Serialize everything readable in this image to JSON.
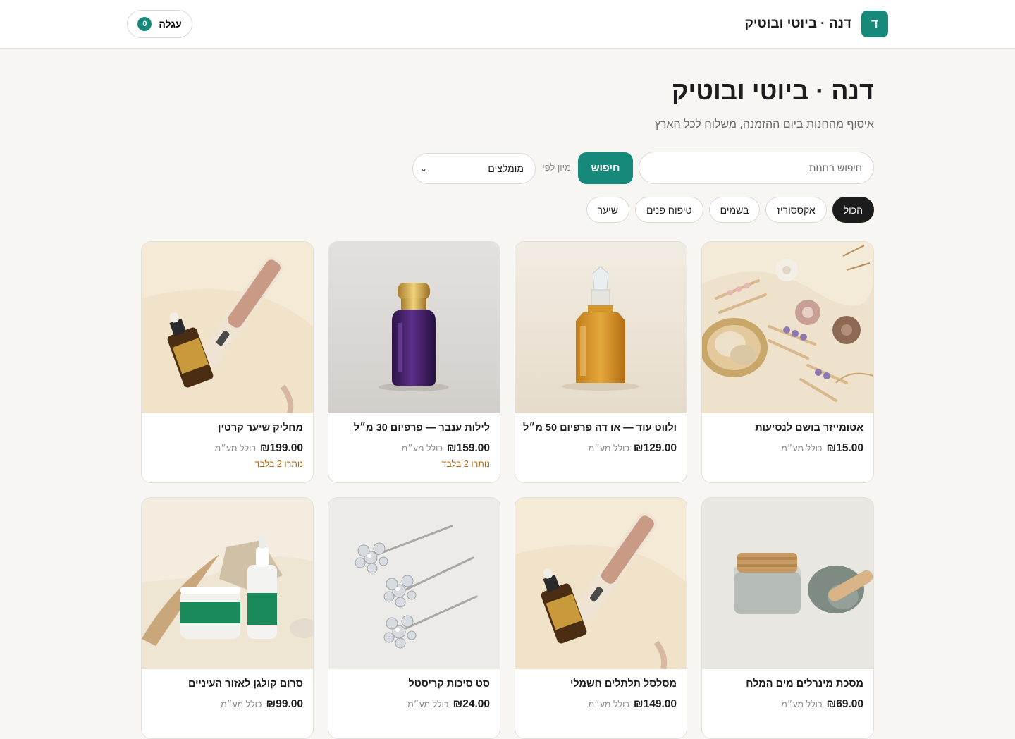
{
  "header": {
    "brand_logo_letter": "ד",
    "brand_name": "דנה · ביוטי ובוטיק",
    "cart_label": "עגלה",
    "cart_count": "0"
  },
  "hero": {
    "title": "דנה · ביוטי ובוטיק",
    "subtitle": "איסוף מהחנות ביום ההזמנה, משלוח לכל הארץ"
  },
  "search": {
    "placeholder": "חיפוש בחנות",
    "button_label": "חיפוש",
    "sort_label": "מיון לפי",
    "sort_value": "מומלצים"
  },
  "categories": [
    "הכול",
    "אקססוריז",
    "בשמים",
    "טיפוח פנים",
    "שיער"
  ],
  "active_category": "הכול",
  "products": [
    {
      "name": "אטומייזר בושם לנסיעות",
      "price": "₪15.00",
      "vat": "כולל מע״מ",
      "stock": ""
    },
    {
      "name": "ולווט עוד — או דה פרפיום 50 מ״ל",
      "price": "₪129.00",
      "vat": "כולל מע״מ",
      "stock": ""
    },
    {
      "name": "לילות ענבר — פרפיום 30 מ״ל",
      "price": "₪159.00",
      "vat": "כולל מע״מ",
      "stock": "נותרו 2 בלבד"
    },
    {
      "name": "מחליק שיער קרטין",
      "price": "₪199.00",
      "vat": "כולל מע״מ",
      "stock": "נותרו 2 בלבד"
    },
    {
      "name": "מסכת מינרלים מים המלח",
      "price": "₪69.00",
      "vat": "כולל מע״מ",
      "stock": ""
    },
    {
      "name": "מסלסל תלתלים חשמלי",
      "price": "₪149.00",
      "vat": "כולל מע״מ",
      "stock": ""
    },
    {
      "name": "סט סיכות קריסטל",
      "price": "₪24.00",
      "vat": "כולל מע״מ",
      "stock": ""
    },
    {
      "name": "סרום קולגן לאזור העיניים",
      "price": "₪99.00",
      "vat": "כולל מע״מ",
      "stock": ""
    }
  ],
  "colors": {
    "accent": "#17897a",
    "stock_warning": "#b16a14",
    "active_chip": "#1c1c1c",
    "page_bg": "#f7f6f3"
  }
}
